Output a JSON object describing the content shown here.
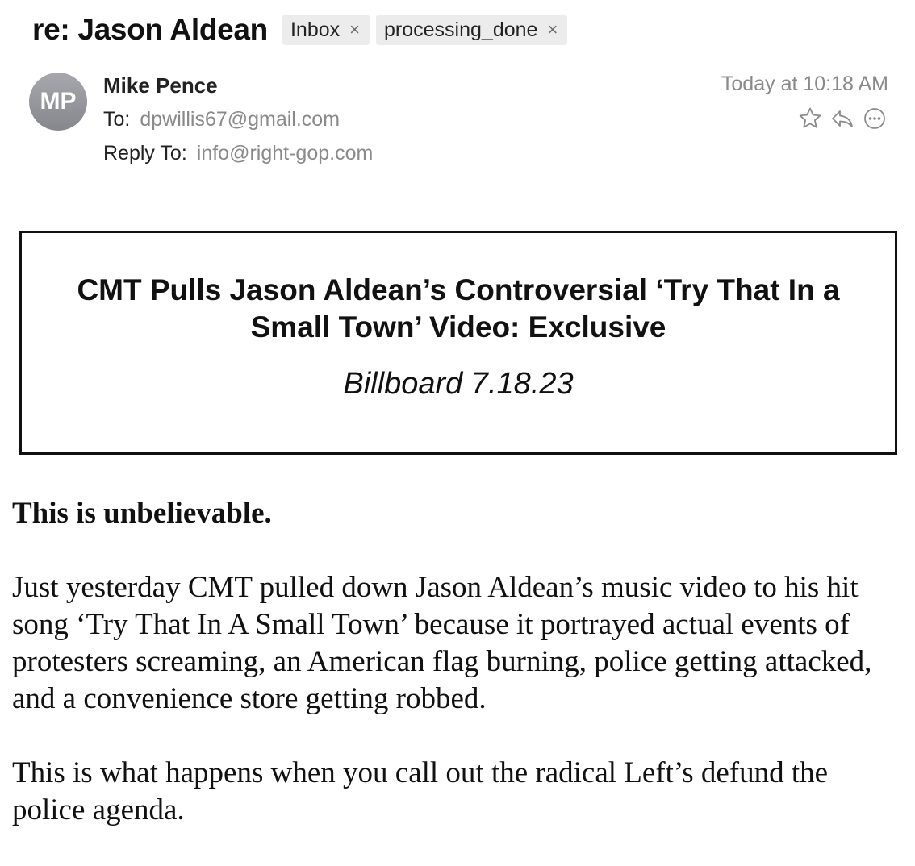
{
  "email": {
    "subject": "re: Jason Aldean",
    "tags": [
      {
        "label": "Inbox",
        "close": "×"
      },
      {
        "label": "processing_done",
        "close": "×"
      }
    ],
    "avatar_initials": "MP",
    "sender_name": "Mike Pence",
    "to_label": "To:",
    "to_value": "dpwillis67@gmail.com",
    "reply_to_label": "Reply To:",
    "reply_to_value": "info@right-gop.com",
    "date": "Today at 10:18 AM",
    "action_icons": [
      "star-icon",
      "reply-icon",
      "more-icon"
    ]
  },
  "body": {
    "headline": "CMT Pulls Jason Aldean’s Controversial ‘Try That In a Small Town’ Video: Exclusive",
    "source": "Billboard 7.18.23",
    "paragraphs": [
      "This is unbelievable.",
      "Just yesterday CMT pulled down Jason Aldean’s music video to his hit song ‘Try That In A Small Town’ because it portrayed actual events of protesters screaming, an American flag burning, police getting attacked, and a convenience store getting robbed.",
      "This is what happens when you call out the radical Left’s defund the police agenda."
    ]
  },
  "colors": {
    "tag_bg": "#ececec",
    "meta_gray": "#8a8a8a",
    "avatar_gray": "#96979c"
  }
}
